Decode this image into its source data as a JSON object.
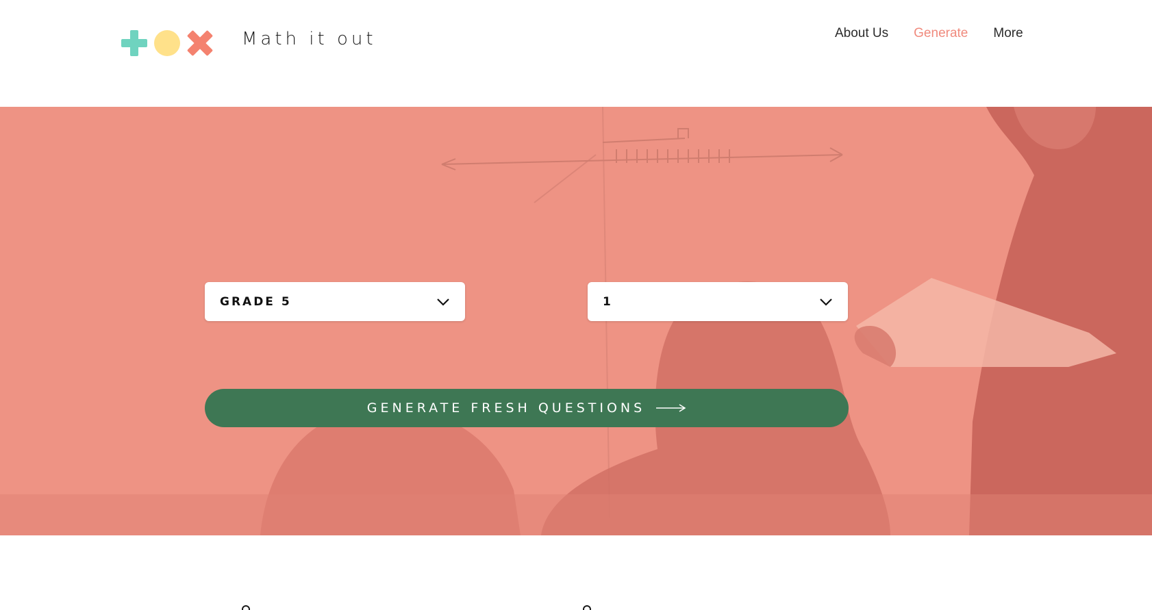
{
  "brand": {
    "name": "Math it out",
    "icons": [
      "plus-icon",
      "circle-icon",
      "times-icon"
    ],
    "colors": {
      "plus": "#6fd3bf",
      "circle": "#ffe18a",
      "times": "#f4826f"
    }
  },
  "nav": {
    "items": [
      {
        "label": "About Us",
        "active": false
      },
      {
        "label": "Generate",
        "active": true
      },
      {
        "label": "More",
        "active": false
      }
    ],
    "active_color": "#f08a7d"
  },
  "hero": {
    "overlay_color": "#ee9384",
    "grade_select": {
      "value": "GRADE 5",
      "icon": "chevron-down-icon"
    },
    "count_select": {
      "value": "1",
      "icon": "chevron-down-icon"
    },
    "cta": {
      "label": "GENERATE FRESH QUESTIONS",
      "icon": "arrow-right-icon",
      "color": "#3e7754"
    }
  }
}
